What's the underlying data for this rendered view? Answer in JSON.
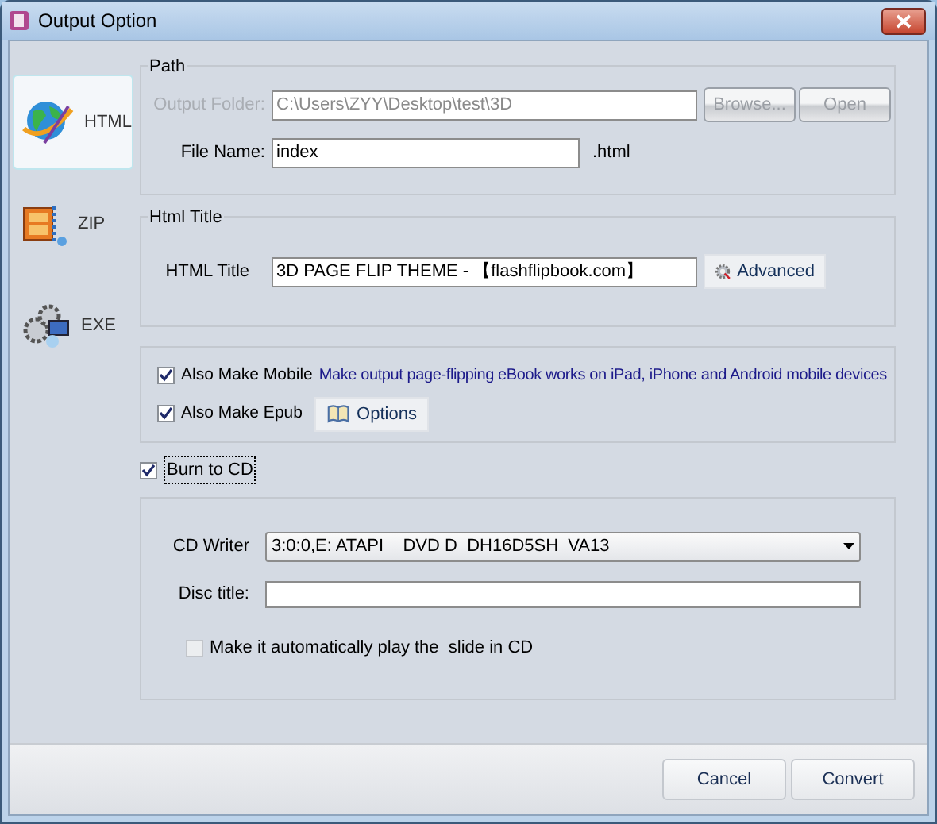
{
  "window": {
    "title": "Output Option"
  },
  "sidebar": {
    "items": [
      {
        "label": "HTML",
        "selected": true,
        "kind": "html"
      },
      {
        "label": "ZIP",
        "selected": false,
        "kind": "zip"
      },
      {
        "label": "EXE",
        "selected": false,
        "kind": "exe"
      }
    ]
  },
  "path_group": {
    "title": "Path",
    "output_folder": {
      "label": "Output Folder:",
      "value": "C:\\Users\\ZYY\\Desktop\\test\\3D",
      "disabled": true
    },
    "buttons": [
      {
        "label": "Browse...",
        "disabled": true
      },
      {
        "label": "Open",
        "disabled": true
      }
    ],
    "file_name": {
      "label": "File Name:",
      "value": "index",
      "suffix": ".html"
    }
  },
  "html_title_group": {
    "title": "Html Title",
    "field": {
      "label": "HTML Title",
      "value": "3D PAGE FLIP THEME - 【flashflipbook.com】"
    },
    "advanced_button": "Advanced"
  },
  "extras": {
    "mobile": {
      "label": "Also Make Mobile",
      "checked": true,
      "description": "Make output page-flipping eBook works on iPad, iPhone and Android mobile devices"
    },
    "epub": {
      "label": "Also Make Epub",
      "checked": true
    },
    "options_button": "Options"
  },
  "burn_to_cd": {
    "label": "Burn to CD",
    "checked": true
  },
  "cd_group": {
    "cd_writer": {
      "label": "CD Writer",
      "value": "3:0:0,E: ATAPI    DVD D  DH16D5SH  VA13"
    },
    "disc_title": {
      "label": "Disc title:"
    },
    "autoplay": {
      "label": "Make it automatically play the  slide in CD",
      "checked": false
    }
  },
  "footer": {
    "buttons": [
      "Cancel",
      "Convert"
    ]
  }
}
